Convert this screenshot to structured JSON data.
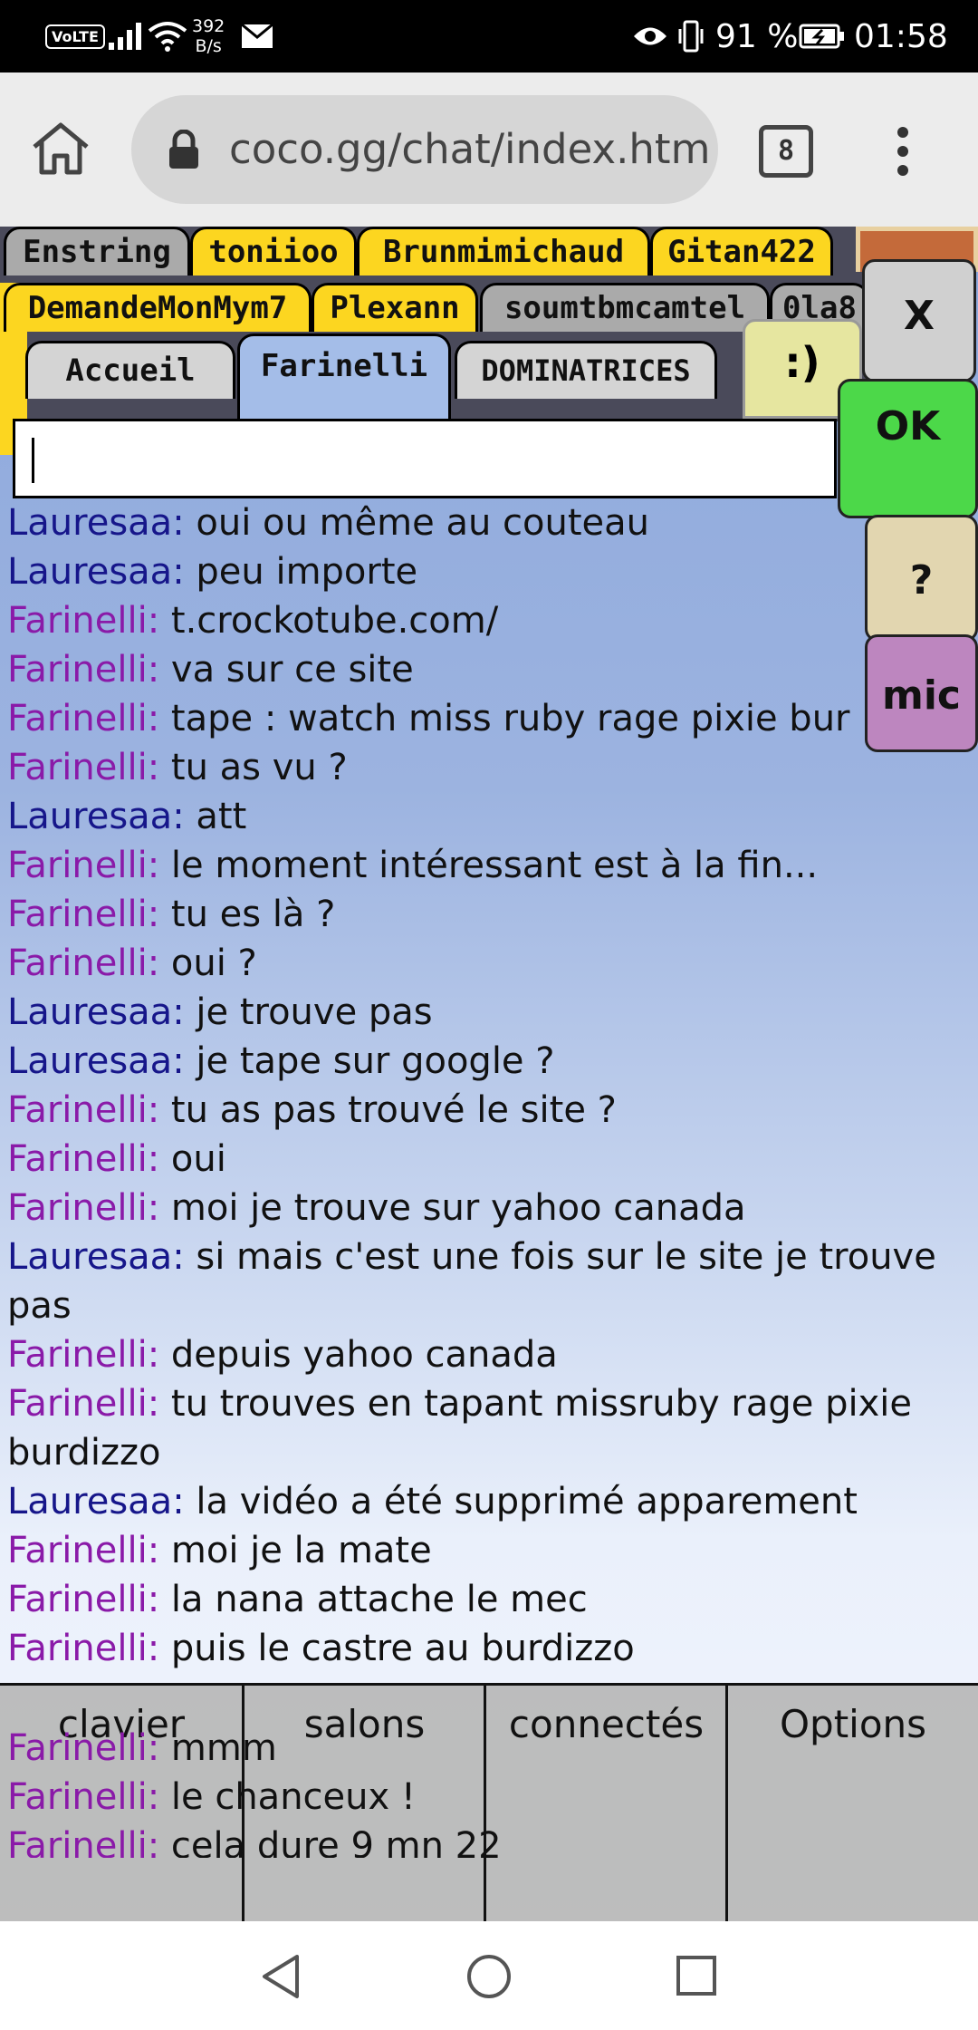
{
  "status_bar": {
    "volte": "VoLTE",
    "net_speed_value": "392",
    "net_speed_unit": "B/s",
    "battery": "91 %",
    "time": "01:58"
  },
  "browser": {
    "url": "coco.gg/chat/index.htm",
    "tab_count": "8"
  },
  "tabs_row1": [
    "Enstring",
    "toniioo",
    "Brunmimichaud",
    "Gitan422"
  ],
  "tabs_row2": [
    "DemandeMonMym7",
    "Plexann",
    "soumtbmcamtel",
    "0la8"
  ],
  "tabs_row3": [
    "Accueil",
    "Farinelli",
    "DOMINATRICES"
  ],
  "smiley": ":)",
  "side_buttons": {
    "close": "X",
    "ok": "OK",
    "help": "?",
    "mic": "mic"
  },
  "input": {
    "value": ""
  },
  "colors": {
    "farinelli_nick": "#8a1aa8",
    "lauresaa_nick": "#16168a",
    "active_tab": "#a4bde8",
    "tab_yellow": "#fcd620"
  },
  "messages": [
    {
      "nick": "Lauresaa:",
      "text": " oui ou même au couteau"
    },
    {
      "nick": "Lauresaa:",
      "text": " peu importe"
    },
    {
      "nick": "Farinelli:",
      "text": " t.crockotube.com/"
    },
    {
      "nick": "Farinelli:",
      "text": " va sur ce site"
    },
    {
      "nick": "Farinelli:",
      "text": " tape : watch miss ruby rage pixie bur"
    },
    {
      "nick": "Farinelli:",
      "text": " tu as vu ?"
    },
    {
      "nick": "Lauresaa:",
      "text": " att"
    },
    {
      "nick": "Farinelli:",
      "text": " le moment intéressant est à la fin..."
    },
    {
      "nick": "Farinelli:",
      "text": " tu es là ?"
    },
    {
      "nick": "Farinelli:",
      "text": " oui ?"
    },
    {
      "nick": "Lauresaa:",
      "text": " je trouve pas"
    },
    {
      "nick": "Lauresaa:",
      "text": " je tape sur google ?"
    },
    {
      "nick": "Farinelli:",
      "text": " tu as pas trouvé le site ?"
    },
    {
      "nick": "Farinelli:",
      "text": " oui"
    },
    {
      "nick": "Farinelli:",
      "text": " moi je trouve sur yahoo canada"
    },
    {
      "nick": "Lauresaa:",
      "text": " si mais c'est une fois sur le site je trouve pas"
    },
    {
      "nick": "Farinelli:",
      "text": " depuis yahoo canada"
    },
    {
      "nick": "Farinelli:",
      "text": " tu trouves en tapant missruby rage pixie burdizzo"
    },
    {
      "nick": "Lauresaa:",
      "text": " la vidéo a été supprimé apparement"
    },
    {
      "nick": "Farinelli:",
      "text": " moi je la mate"
    },
    {
      "nick": "Farinelli:",
      "text": " la nana attache le mec"
    },
    {
      "nick": "Farinelli:",
      "text": " puis le castre au burdizzo"
    }
  ],
  "overflow_messages": [
    {
      "nick": "Farinelli:",
      "text": " mmm"
    },
    {
      "nick": "Farinelli:",
      "text": " le chanceux !"
    },
    {
      "nick": "Farinelli:",
      "text": " cela dure 9 mn 22"
    }
  ],
  "bottom_menu": [
    "clavier",
    "salons",
    "connectés",
    "Options"
  ]
}
